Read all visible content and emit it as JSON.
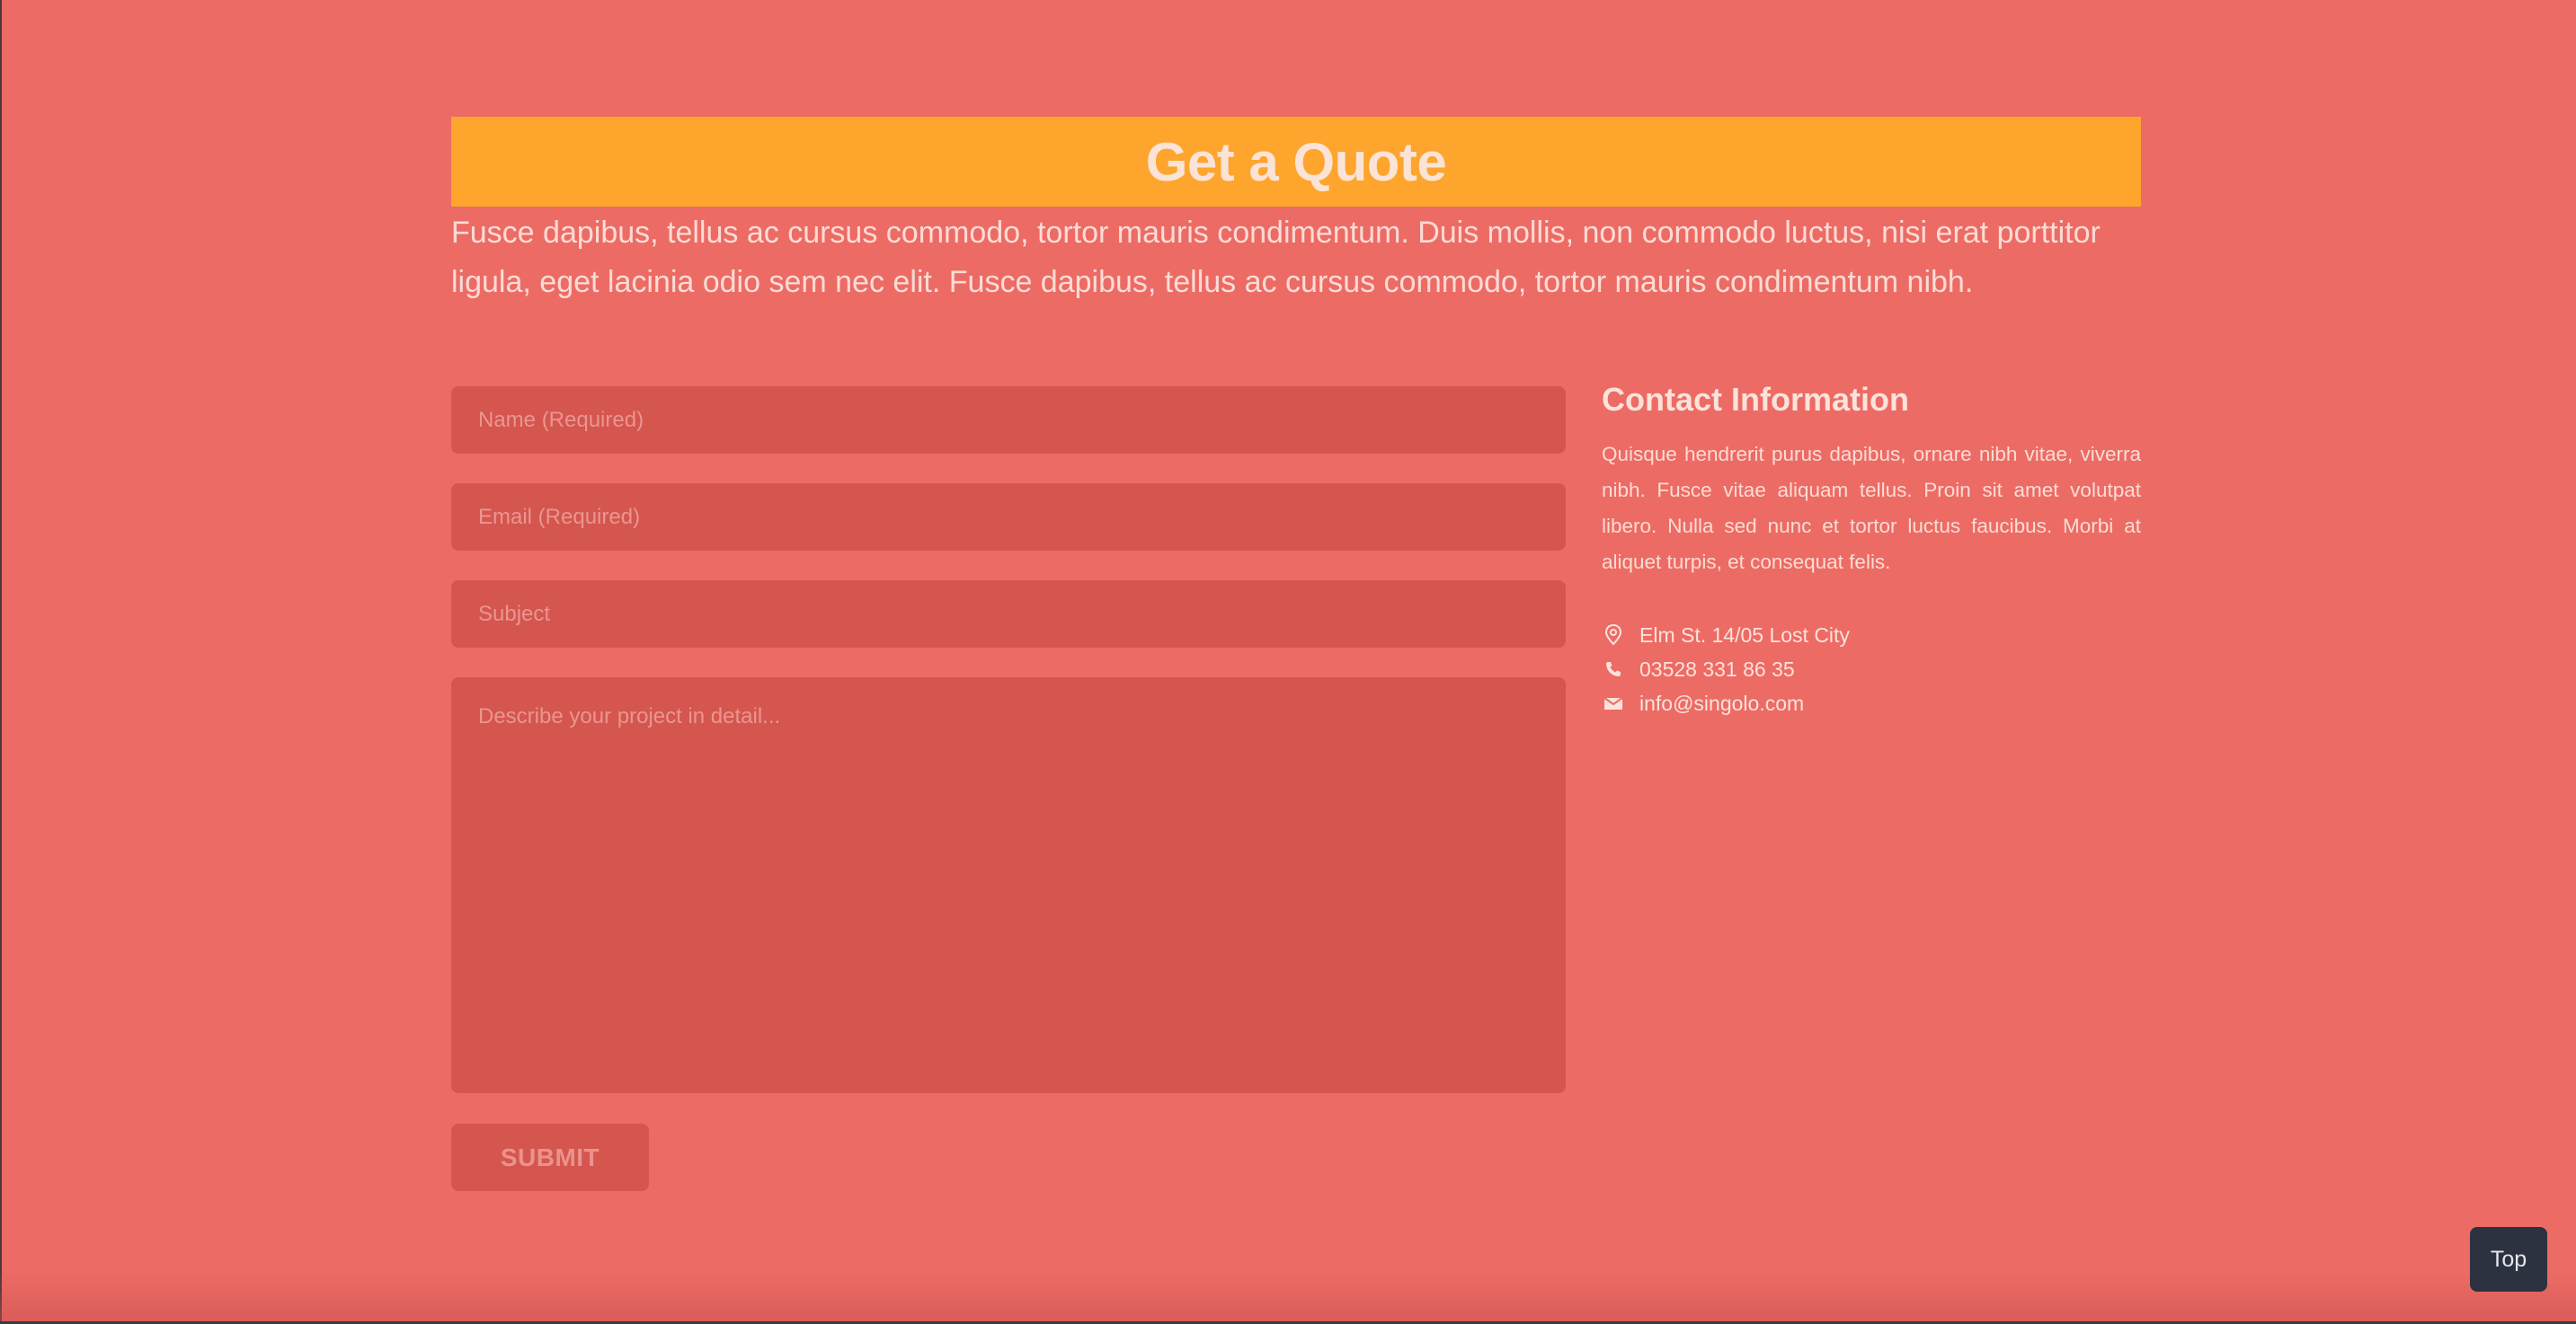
{
  "quote": {
    "title": "Get a Quote",
    "intro": "Fusce dapibus, tellus ac cursus commodo, tortor mauris condimentum. Duis mollis, non commodo luctus, nisi erat porttitor ligula, eget lacinia odio sem nec elit. Fusce dapibus, tellus ac cursus commodo, tortor mauris condimentum nibh."
  },
  "form": {
    "name_placeholder": "Name (Required)",
    "email_placeholder": "Email (Required)",
    "subject_placeholder": "Subject",
    "description_placeholder": "Describe your project in detail...",
    "submit_label": "SUBMIT"
  },
  "contact": {
    "title": "Contact Information",
    "description": "Quisque hendrerit purus dapibus, ornare nibh vitae, viverra nibh. Fusce vitae aliquam tellus. Proin sit amet volutpat libero. Nulla sed nunc et tortor luctus faucibus. Morbi at aliquet turpis, et consequat felis.",
    "address": "Elm St. 14/05 Lost City",
    "phone": "03528 331 86 35",
    "email": "info@singolo.com",
    "address_icon": "map-pin-icon",
    "phone_icon": "phone-icon",
    "email_icon": "envelope-icon"
  },
  "top_button": {
    "label": "Top"
  },
  "colors": {
    "background": "#ed6b65",
    "banner": "#fea52e",
    "field": "#d4564f",
    "top_button": "#2c3240"
  }
}
